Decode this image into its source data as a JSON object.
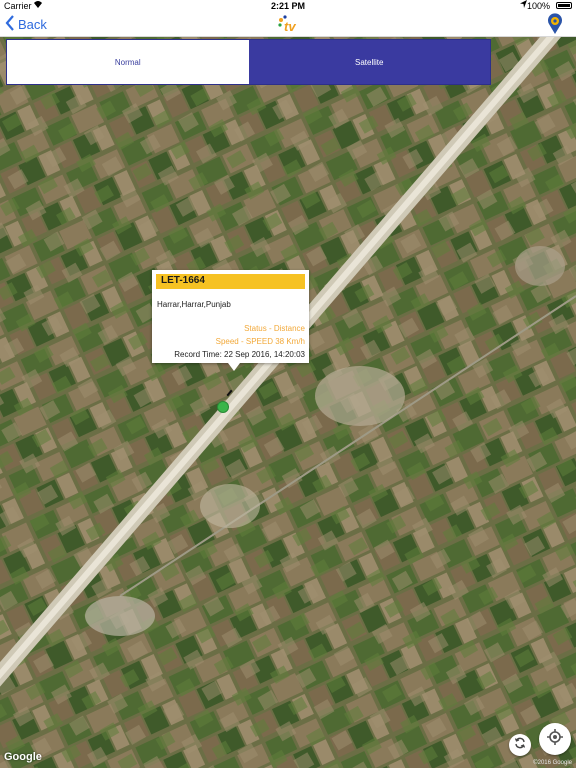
{
  "status_bar": {
    "carrier": "Carrier",
    "time": "2:21 PM",
    "battery": "100%"
  },
  "nav": {
    "back_label": "Back",
    "logo_text": "tv"
  },
  "map_type": {
    "options": [
      "Normal",
      "Satellite"
    ],
    "selected": "Satellite"
  },
  "info_window": {
    "title": "LET-1664",
    "address": "Harrar,Harrar,Punjab",
    "status": "Status - Distance",
    "speed": "Speed - SPEED 38 Km/h",
    "record_time": "Record Time: 22 Sep 2016, 14:20:03"
  },
  "map_footer": {
    "google_logo": "Google",
    "copyright": "©2016 Google"
  },
  "colors": {
    "accent": "#2f6bde",
    "segment_selected": "#3a3aa0",
    "info_title_bar": "#f6c223",
    "info_highlight_text": "#f2a93a",
    "vehicle_marker": "#3ab54a"
  },
  "icons": [
    "wifi-icon",
    "location-arrow-icon",
    "battery-icon",
    "chevron-left-icon",
    "map-pin-icon",
    "refresh-icon",
    "crosshair-icon"
  ]
}
